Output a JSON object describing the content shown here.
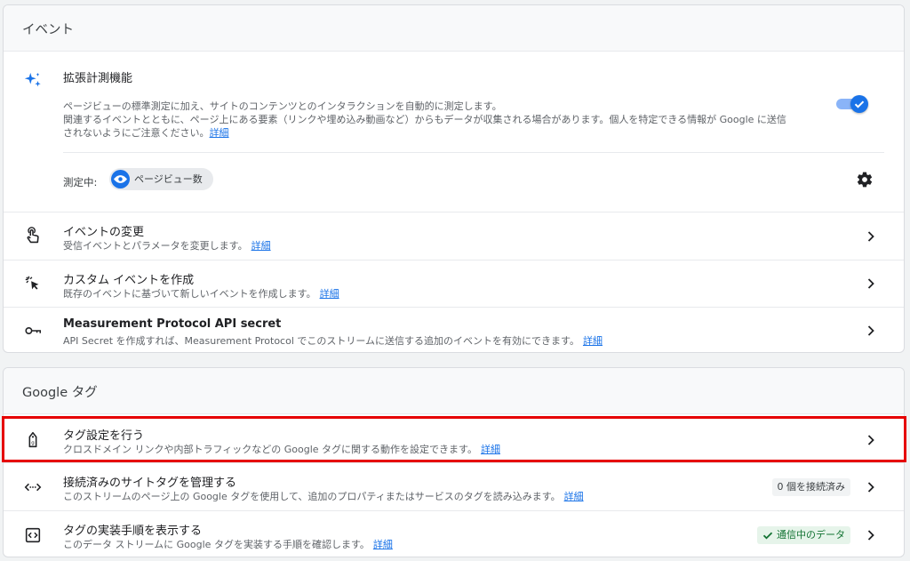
{
  "events_section": {
    "header": "イベント",
    "enhanced": {
      "title": "拡張計測機能",
      "desc_line1": "ページビューの標準測定に加え、サイトのコンテンツとのインタラクションを自動的に測定します。",
      "desc_line2": "関連するイベントとともに、ページ上にある要素（リンクや埋め込み動画など）からもデータが収集される場合があります。個人を特定できる情報が Google に送信",
      "desc_line3": "されないようにご注意ください。",
      "detail_link": "詳細",
      "measuring_label": "測定中:",
      "chip_label": "ページビュー数",
      "toggle_on": true
    },
    "rows": [
      {
        "title": "イベントの変更",
        "subtitle": "受信イベントとパラメータを変更します。",
        "link": "詳細"
      },
      {
        "title": "カスタム イベントを作成",
        "subtitle": "既存のイベントに基づいて新しいイベントを作成します。",
        "link": "詳細"
      },
      {
        "title": "Measurement Protocol API secret",
        "subtitle": "API Secret を作成すれば、Measurement Protocol でこのストリームに送信する追加のイベントを有効にできます。",
        "link": "詳細"
      }
    ]
  },
  "gtag_section": {
    "header": "Google タグ",
    "rows": [
      {
        "title": "タグ設定を行う",
        "subtitle": "クロスドメイン リンクや内部トラフィックなどの Google タグに関する動作を設定できます。",
        "link": "詳細"
      },
      {
        "title": "接続済みのサイトタグを管理する",
        "subtitle": "このストリームのページ上の Google タグを使用して、追加のプロパティまたはサービスのタグを読み込みます。",
        "link": "詳細",
        "badge": "0 個を接続済み"
      },
      {
        "title": "タグの実装手順を表示する",
        "subtitle": "このデータ ストリームに Google タグを実装する手順を確認します。",
        "link": "詳細",
        "badge": "通信中のデータ"
      }
    ]
  },
  "colors": {
    "accent": "#1a73e8",
    "highlight": "#e60000",
    "status_green": "#137333"
  },
  "icons": {
    "enhanced": "sparkle-icon",
    "modify": "touch-icon",
    "custom": "cursor-click-icon",
    "secret": "key-icon",
    "tag_settings": "tag-icon",
    "connected": "code-arrows-icon",
    "instructions": "code-box-icon",
    "gear": "gear-icon",
    "chevron": "chevron-right-icon"
  }
}
